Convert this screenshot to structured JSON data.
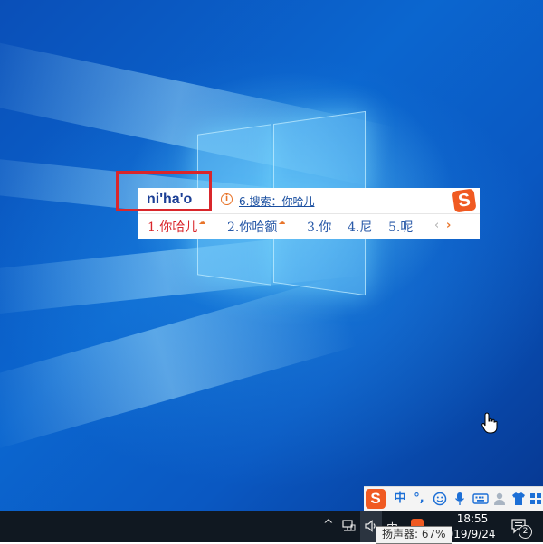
{
  "ime": {
    "composition": "ni'ha'o",
    "search_suggestion": "6.搜索：你哈儿",
    "logo_letter": "S",
    "candidates": [
      {
        "label": "1.你哈儿",
        "cloud": true
      },
      {
        "label": "2.你哈额",
        "cloud": true
      },
      {
        "label": "3.你",
        "cloud": false
      },
      {
        "label": "4.尼",
        "cloud": false
      },
      {
        "label": "5.呢",
        "cloud": false
      }
    ],
    "prev_page": "‹",
    "next_page": "›"
  },
  "ime_status_bar": {
    "logo": "S",
    "mode": "中",
    "punct": "°,",
    "icons": [
      "emoji-icon",
      "microphone-icon",
      "keyboard-icon",
      "user-icon",
      "skin-shirt-icon",
      "toolbox-grid-icon"
    ]
  },
  "taskbar": {
    "time": "18:55",
    "date": "2019/9/24",
    "volume_tooltip": "扬声器: 67%",
    "notification_count": "2",
    "tray_overflow": "^",
    "input_indicator": "中"
  },
  "colors": {
    "highlight_box": "#d9262b",
    "sogou_orange": "#f05a22",
    "candidate_blue": "#2a5aa8",
    "candidate_red": "#d9262b",
    "taskbar": "#101821"
  }
}
